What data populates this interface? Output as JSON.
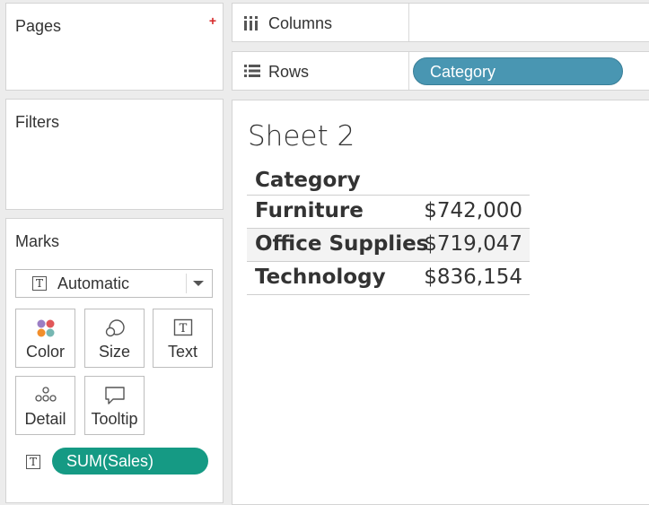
{
  "pages": {
    "title": "Pages"
  },
  "filters": {
    "title": "Filters"
  },
  "marks": {
    "title": "Marks",
    "mark_type": "Automatic",
    "buttons": {
      "color": "Color",
      "size": "Size",
      "text": "Text",
      "detail": "Detail",
      "tooltip": "Tooltip"
    },
    "text_field": "SUM(Sales)"
  },
  "shelves": {
    "columns_label": "Columns",
    "rows_label": "Rows",
    "rows_pill": "Category"
  },
  "sheet": {
    "title": "Sheet 2",
    "header": "Category",
    "rows": [
      {
        "category": "Furniture",
        "value": "$742,000"
      },
      {
        "category": "Office Supplies",
        "value": "$719,047"
      },
      {
        "category": "Technology",
        "value": "$836,154"
      }
    ]
  },
  "colors": {
    "category_pill": "#4996b2",
    "measure_pill": "#159a84",
    "add_icon": "#d62728"
  },
  "icons": [
    "plus-icon",
    "text-mark-icon",
    "dropdown-caret-icon",
    "color-dots-icon",
    "size-circles-icon",
    "detail-dots-icon",
    "tooltip-bubble-icon",
    "columns-icon",
    "rows-icon"
  ]
}
